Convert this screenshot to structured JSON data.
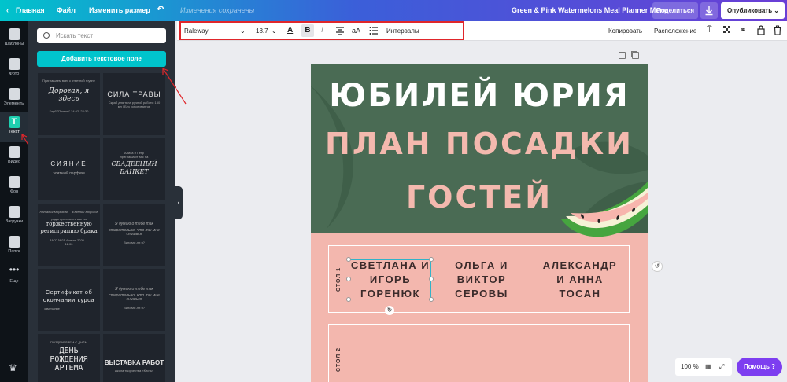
{
  "topbar": {
    "home": "Главная",
    "file": "Файл",
    "resize": "Изменить размер",
    "saved_status": "Изменения сохранены",
    "doc_title": "Green & Pink Watermelons Meal Planner Menu",
    "share": "Поделиться",
    "publish": "Опубликовать"
  },
  "rail": {
    "templates": "Шаблоны",
    "photos": "Фото",
    "elements": "Элементы",
    "text": "Текст",
    "video": "Видео",
    "bg": "Фон",
    "uploads": "Загрузки",
    "folders": "Папки",
    "more": "Еще"
  },
  "panel": {
    "search_placeholder": "Искать текст",
    "add_text": "Добавить текстовое поле",
    "tiles": {
      "t1_small": "Приглашаем всех к ответной группе",
      "t1_main": "Дорогая, я здесь",
      "t1_sub": "Клуб \"Пряник\" 24.02, 22:30",
      "t2_main": "СИЛА ТРАВЫ",
      "t2_sub": "Скраб для тела ручной работы 150 мл | Без консервантов",
      "t3_main": "СИЯНИЕ",
      "t3_sub": "элитный парфюм",
      "t4_small": "Алиса и Петр приглашают вас на",
      "t4_main": "СВАДЕБНЫЙ БАНКЕТ",
      "t5_small1": "Наталья Морозова",
      "t5_small2": "Евгений Морозов",
      "t5_small3": "рады пригласить вас на",
      "t5_main": "торжественную регистрацию брака",
      "t5_sub": "ЗАГС №21 4 июля 2020 — 12:00",
      "t6_main1": "Я думаю о тебе так",
      "t6_main2": "старательно, что ты мне снишься",
      "t6_sub": "Виноват-ли я?",
      "t7_main": "Сертификат об окончании курса",
      "t7_sub": "замечание",
      "t8_main1": "Я думаю о тебе так",
      "t8_main2": "старательно, что ты мне снишься",
      "t8_sub": "Виноват-ли я?",
      "t9_small": "ПОЗДРАВЛЯЕМ С ДНЁМ",
      "t9_main": "ДЕНЬ РОЖДЕНИЯ АРТЕМА",
      "t10_main": "ВЫСТАВКА РАБОТ",
      "t10_sub": "школа творчества «Кисть»"
    }
  },
  "toolbar": {
    "font": "Raleway",
    "size": "18.7",
    "spacing": "Интервалы",
    "copy": "Копировать",
    "position": "Расположение"
  },
  "design": {
    "title1": "ЮБИЛЕЙ ЮРИЯ",
    "title2": "ПЛАН ПОСАДКИ",
    "title3": "ГОСТЕЙ",
    "table1_label": "СТОЛ 1",
    "table2_label": "СТОЛ 2",
    "guest1_l1": "СВЕТЛАНА И",
    "guest1_l2": "ИГОРЬ",
    "guest1_l3": "ГОРЕНЮК",
    "guest2_l1": "ОЛЬГА И",
    "guest2_l2": "ВИКТОР",
    "guest2_l3": "СЕРОВЫ",
    "guest3_l1": "АЛЕКСАНДР",
    "guest3_l2": "И АННА",
    "guest3_l3": "ТОСАН"
  },
  "footer": {
    "zoom": "100 %",
    "help": "Помощь"
  }
}
